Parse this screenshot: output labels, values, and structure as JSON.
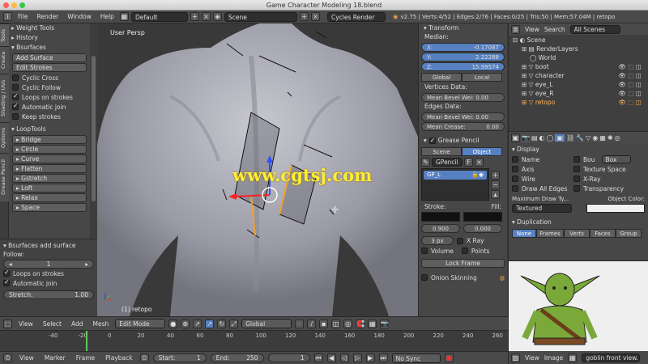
{
  "window": {
    "title": "Game Character Modeling 18.blend"
  },
  "menubar": {
    "items": [
      "File",
      "Render",
      "Window",
      "Help"
    ],
    "layout": "Default",
    "scene": "Scene",
    "engine": "Cycles Render",
    "stats": "v2.75 | Verts:4/52 | Edges:2/76 | Faces:0/25 | Tris:50 | Mem:57.04M | retopo"
  },
  "vtabs": [
    "Tools",
    "Create",
    "Shading / UVs",
    "Options",
    "Grease Pencil"
  ],
  "tool_panel": {
    "weight_tools": "Weight Tools",
    "history": "History",
    "bsurfaces": "Bsurfaces",
    "add_surface": "Add Surface",
    "edit_strokes": "Edit Strokes",
    "cyclic_cross": "Cyclic Cross",
    "cyclic_follow": "Cyclic Follow",
    "loops_on_strokes": "Loops on strokes",
    "automatic_join": "Automatic join",
    "keep_strokes": "Keep strokes",
    "looptools": "LoopTools",
    "loop_items": [
      "Bridge",
      "Circle",
      "Curve",
      "Flatten",
      "Gstretch",
      "Loft",
      "Relax",
      "Space"
    ],
    "add_surface_panel": "Bsurfaces add surface",
    "follow_label": "Follow:",
    "follow_value": "1",
    "loops2": "Loops on strokes",
    "autojoin2": "Automatic join",
    "stretch_label": "Stretch:",
    "stretch_value": "1.00"
  },
  "viewport": {
    "label": "User Persp",
    "object": "(1) retopo",
    "watermark": "www.cgtsj.com"
  },
  "transform": {
    "title": "Transform",
    "median": "Median:",
    "x_label": "X:",
    "x_value": "-0.17087",
    "y_label": "Y:",
    "y_value": "2.22288",
    "z_label": "Z:",
    "z_value": "15.99574",
    "global": "Global",
    "local": "Local",
    "vertices_data": "Vertices Data:",
    "vert_bevel": "Mean Bevel Wei: 0.00",
    "edges_data": "Edges Data:",
    "edge_bevel": "Mean Bevel Wei: 0.00",
    "edge_crease": "Mean Crease:",
    "edge_crease_value": "0.00"
  },
  "grease": {
    "title": "Grease Pencil",
    "scene": "Scene",
    "object": "Object",
    "gpencil": "GPencil",
    "f": "F",
    "layer": "GP_L",
    "stroke": "Stroke:",
    "fill": "Fill:",
    "stroke_val": "0.900",
    "fill_val": "0.000",
    "px": "3 px",
    "xray": "X Ray",
    "volume": "Volume",
    "points": "Points",
    "lock_frame": "Lock Frame",
    "onion": "Onion Skinning"
  },
  "outliner": {
    "view": "View",
    "search": "Search",
    "scenes": "All Scenes",
    "items": [
      "Scene",
      "RenderLayers",
      "World",
      "boot",
      "character",
      "eye_L",
      "eye_R",
      "retopo"
    ]
  },
  "display": {
    "title": "Display",
    "name": "Name",
    "bou": "Bou",
    "box": "Box",
    "axis": "Axis",
    "texture_space": "Texture Space",
    "wire": "Wire",
    "xray": "X-Ray",
    "draw_all_edges": "Draw All Edges",
    "transparency": "Transparency",
    "max_draw": "Maximum Draw Ty...",
    "object_color": "Object Color:",
    "textured": "Textured"
  },
  "duplication": {
    "title": "Duplication",
    "tabs": [
      "None",
      "Frames",
      "Verts",
      "Faces",
      "Group"
    ]
  },
  "image_editor": {
    "view": "View",
    "image": "Image",
    "file": "goblin front view."
  },
  "viewport_header": {
    "view": "View",
    "select": "Select",
    "add": "Add",
    "mesh": "Mesh",
    "mode": "Edit Mode",
    "orientation": "Global"
  },
  "timeline": {
    "ticks": [
      "-40",
      "-20",
      "0",
      "20",
      "40",
      "60",
      "80",
      "100",
      "120",
      "140",
      "160",
      "180",
      "200",
      "220",
      "240",
      "260"
    ],
    "view": "View",
    "marker": "Marker",
    "frame": "Frame",
    "playback": "Playback",
    "start_label": "Start:",
    "start": "1",
    "end_label": "End:",
    "end": "250",
    "current": "1",
    "sync": "No Sync"
  },
  "colors": {
    "accent": "#5680c2",
    "header": "#4a4a4a",
    "panel": "#474747"
  }
}
